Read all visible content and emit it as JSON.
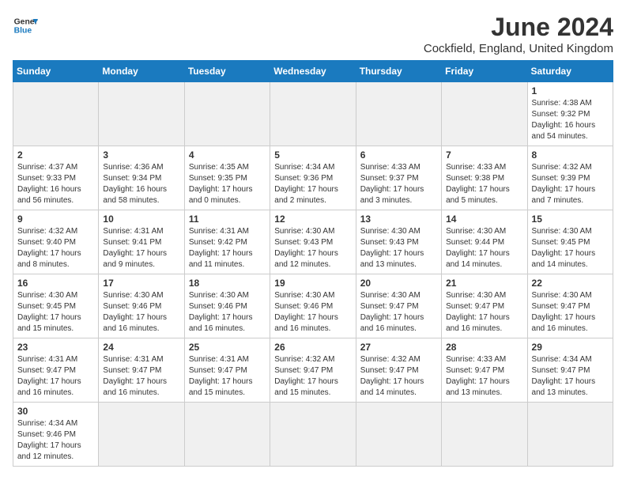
{
  "header": {
    "logo_text_general": "General",
    "logo_text_blue": "Blue",
    "month_title": "June 2024",
    "location": "Cockfield, England, United Kingdom"
  },
  "weekdays": [
    "Sunday",
    "Monday",
    "Tuesday",
    "Wednesday",
    "Thursday",
    "Friday",
    "Saturday"
  ],
  "days": [
    {
      "day": "",
      "sunrise": "",
      "sunset": "",
      "daylight": ""
    },
    {
      "day": "",
      "sunrise": "",
      "sunset": "",
      "daylight": ""
    },
    {
      "day": "",
      "sunrise": "",
      "sunset": "",
      "daylight": ""
    },
    {
      "day": "",
      "sunrise": "",
      "sunset": "",
      "daylight": ""
    },
    {
      "day": "",
      "sunrise": "",
      "sunset": "",
      "daylight": ""
    },
    {
      "day": "",
      "sunrise": "",
      "sunset": "",
      "daylight": ""
    },
    {
      "day": "1",
      "sunrise": "Sunrise: 4:38 AM",
      "sunset": "Sunset: 9:32 PM",
      "daylight": "Daylight: 16 hours and 54 minutes."
    }
  ],
  "week2": [
    {
      "day": "2",
      "sunrise": "Sunrise: 4:37 AM",
      "sunset": "Sunset: 9:33 PM",
      "daylight": "Daylight: 16 hours and 56 minutes."
    },
    {
      "day": "3",
      "sunrise": "Sunrise: 4:36 AM",
      "sunset": "Sunset: 9:34 PM",
      "daylight": "Daylight: 16 hours and 58 minutes."
    },
    {
      "day": "4",
      "sunrise": "Sunrise: 4:35 AM",
      "sunset": "Sunset: 9:35 PM",
      "daylight": "Daylight: 17 hours and 0 minutes."
    },
    {
      "day": "5",
      "sunrise": "Sunrise: 4:34 AM",
      "sunset": "Sunset: 9:36 PM",
      "daylight": "Daylight: 17 hours and 2 minutes."
    },
    {
      "day": "6",
      "sunrise": "Sunrise: 4:33 AM",
      "sunset": "Sunset: 9:37 PM",
      "daylight": "Daylight: 17 hours and 3 minutes."
    },
    {
      "day": "7",
      "sunrise": "Sunrise: 4:33 AM",
      "sunset": "Sunset: 9:38 PM",
      "daylight": "Daylight: 17 hours and 5 minutes."
    },
    {
      "day": "8",
      "sunrise": "Sunrise: 4:32 AM",
      "sunset": "Sunset: 9:39 PM",
      "daylight": "Daylight: 17 hours and 7 minutes."
    }
  ],
  "week3": [
    {
      "day": "9",
      "sunrise": "Sunrise: 4:32 AM",
      "sunset": "Sunset: 9:40 PM",
      "daylight": "Daylight: 17 hours and 8 minutes."
    },
    {
      "day": "10",
      "sunrise": "Sunrise: 4:31 AM",
      "sunset": "Sunset: 9:41 PM",
      "daylight": "Daylight: 17 hours and 9 minutes."
    },
    {
      "day": "11",
      "sunrise": "Sunrise: 4:31 AM",
      "sunset": "Sunset: 9:42 PM",
      "daylight": "Daylight: 17 hours and 11 minutes."
    },
    {
      "day": "12",
      "sunrise": "Sunrise: 4:30 AM",
      "sunset": "Sunset: 9:43 PM",
      "daylight": "Daylight: 17 hours and 12 minutes."
    },
    {
      "day": "13",
      "sunrise": "Sunrise: 4:30 AM",
      "sunset": "Sunset: 9:43 PM",
      "daylight": "Daylight: 17 hours and 13 minutes."
    },
    {
      "day": "14",
      "sunrise": "Sunrise: 4:30 AM",
      "sunset": "Sunset: 9:44 PM",
      "daylight": "Daylight: 17 hours and 14 minutes."
    },
    {
      "day": "15",
      "sunrise": "Sunrise: 4:30 AM",
      "sunset": "Sunset: 9:45 PM",
      "daylight": "Daylight: 17 hours and 14 minutes."
    }
  ],
  "week4": [
    {
      "day": "16",
      "sunrise": "Sunrise: 4:30 AM",
      "sunset": "Sunset: 9:45 PM",
      "daylight": "Daylight: 17 hours and 15 minutes."
    },
    {
      "day": "17",
      "sunrise": "Sunrise: 4:30 AM",
      "sunset": "Sunset: 9:46 PM",
      "daylight": "Daylight: 17 hours and 16 minutes."
    },
    {
      "day": "18",
      "sunrise": "Sunrise: 4:30 AM",
      "sunset": "Sunset: 9:46 PM",
      "daylight": "Daylight: 17 hours and 16 minutes."
    },
    {
      "day": "19",
      "sunrise": "Sunrise: 4:30 AM",
      "sunset": "Sunset: 9:46 PM",
      "daylight": "Daylight: 17 hours and 16 minutes."
    },
    {
      "day": "20",
      "sunrise": "Sunrise: 4:30 AM",
      "sunset": "Sunset: 9:47 PM",
      "daylight": "Daylight: 17 hours and 16 minutes."
    },
    {
      "day": "21",
      "sunrise": "Sunrise: 4:30 AM",
      "sunset": "Sunset: 9:47 PM",
      "daylight": "Daylight: 17 hours and 16 minutes."
    },
    {
      "day": "22",
      "sunrise": "Sunrise: 4:30 AM",
      "sunset": "Sunset: 9:47 PM",
      "daylight": "Daylight: 17 hours and 16 minutes."
    }
  ],
  "week5": [
    {
      "day": "23",
      "sunrise": "Sunrise: 4:31 AM",
      "sunset": "Sunset: 9:47 PM",
      "daylight": "Daylight: 17 hours and 16 minutes."
    },
    {
      "day": "24",
      "sunrise": "Sunrise: 4:31 AM",
      "sunset": "Sunset: 9:47 PM",
      "daylight": "Daylight: 17 hours and 16 minutes."
    },
    {
      "day": "25",
      "sunrise": "Sunrise: 4:31 AM",
      "sunset": "Sunset: 9:47 PM",
      "daylight": "Daylight: 17 hours and 15 minutes."
    },
    {
      "day": "26",
      "sunrise": "Sunrise: 4:32 AM",
      "sunset": "Sunset: 9:47 PM",
      "daylight": "Daylight: 17 hours and 15 minutes."
    },
    {
      "day": "27",
      "sunrise": "Sunrise: 4:32 AM",
      "sunset": "Sunset: 9:47 PM",
      "daylight": "Daylight: 17 hours and 14 minutes."
    },
    {
      "day": "28",
      "sunrise": "Sunrise: 4:33 AM",
      "sunset": "Sunset: 9:47 PM",
      "daylight": "Daylight: 17 hours and 13 minutes."
    },
    {
      "day": "29",
      "sunrise": "Sunrise: 4:34 AM",
      "sunset": "Sunset: 9:47 PM",
      "daylight": "Daylight: 17 hours and 13 minutes."
    }
  ],
  "week6": [
    {
      "day": "30",
      "sunrise": "Sunrise: 4:34 AM",
      "sunset": "Sunset: 9:46 PM",
      "daylight": "Daylight: 17 hours and 12 minutes."
    },
    {
      "day": "",
      "sunrise": "",
      "sunset": "",
      "daylight": ""
    },
    {
      "day": "",
      "sunrise": "",
      "sunset": "",
      "daylight": ""
    },
    {
      "day": "",
      "sunrise": "",
      "sunset": "",
      "daylight": ""
    },
    {
      "day": "",
      "sunrise": "",
      "sunset": "",
      "daylight": ""
    },
    {
      "day": "",
      "sunrise": "",
      "sunset": "",
      "daylight": ""
    },
    {
      "day": "",
      "sunrise": "",
      "sunset": "",
      "daylight": ""
    }
  ]
}
